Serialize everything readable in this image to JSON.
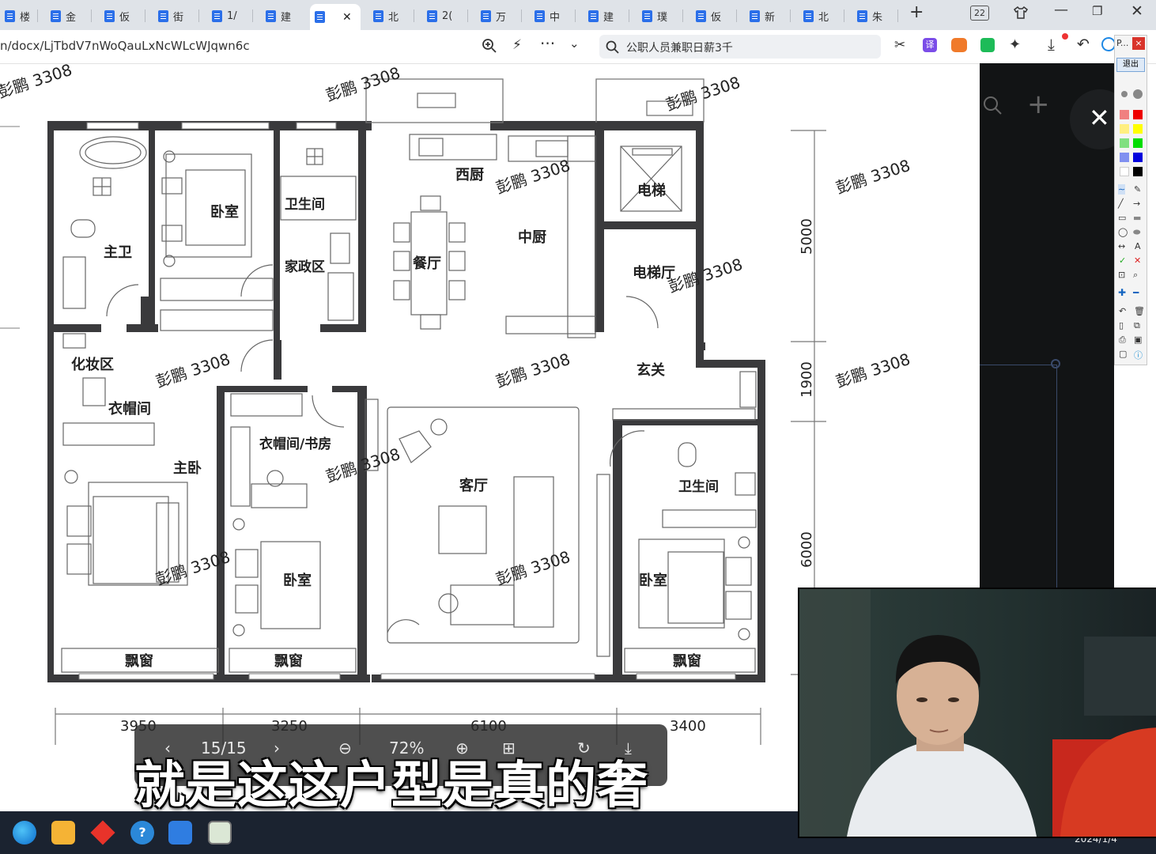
{
  "tabs": [
    {
      "label": "楼"
    },
    {
      "label": "金"
    },
    {
      "label": "仮"
    },
    {
      "label": "街"
    },
    {
      "label": "1/"
    },
    {
      "label": "建"
    },
    {
      "label": ""
    },
    {
      "label": "北"
    },
    {
      "label": "2("
    },
    {
      "label": "万"
    },
    {
      "label": "中"
    },
    {
      "label": "建"
    },
    {
      "label": "璞"
    },
    {
      "label": "仮"
    },
    {
      "label": "新"
    },
    {
      "label": "北"
    },
    {
      "label": "朱"
    }
  ],
  "tab_count_badge": "22",
  "address": {
    "url": "n/docx/LjTbdV7nWoQauLxNcWLcWJqwn6c",
    "search_text": "公职人员兼职日薪3千"
  },
  "annotation_toolbar": {
    "title": "P...",
    "exit_label": "退出",
    "text_tool": "A"
  },
  "floorplan": {
    "rooms": {
      "main_bath": "主卫",
      "bedroom_nw": "卧室",
      "bathroom_1": "卫生间",
      "western_kitchen": "西厨",
      "chinese_kitchen": "中厨",
      "elevator": "电梯",
      "elevator_hall": "电梯厅",
      "dining": "餐厅",
      "housekeeping": "家政区",
      "vanity": "化妆区",
      "walkin_closet": "衣帽间",
      "master_bedroom": "主卧",
      "closet_study": "衣帽间/书房",
      "living_room": "客厅",
      "foyer": "玄关",
      "bathroom_2": "卫生间",
      "bedroom_mid": "卧室",
      "bedroom_se": "卧室",
      "bay_1": "飘窗",
      "bay_2": "飘窗",
      "bay_3": "飘窗"
    },
    "dims_bottom": [
      "3950",
      "3250",
      "6100",
      "3400"
    ],
    "dims_right": [
      "5000",
      "1900",
      "6000"
    ],
    "watermark": "彭鹏 3308"
  },
  "viewer": {
    "page": "15/15",
    "zoom": "72%"
  },
  "subtitle": "就是这这户型是真的奢",
  "taskbar": {
    "date": "2024/1/4"
  },
  "colors": {
    "tab_strip": "#dfe3e8",
    "doc_icon": "#2b6fe9",
    "wall": "#3a3a3c",
    "taskbar": "#1b2330"
  }
}
